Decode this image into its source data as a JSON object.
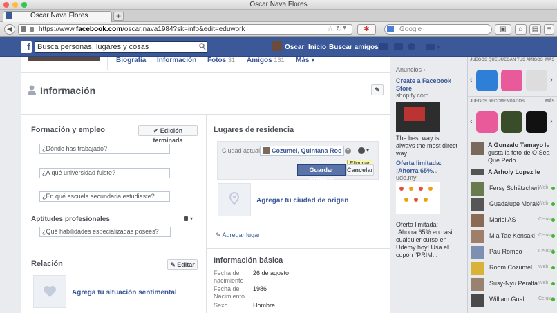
{
  "window": {
    "title": "Oscar Nava Flores",
    "tab_title": "Oscar Nava Flores",
    "new_tab": "+"
  },
  "toolbar": {
    "url_prefix": "https://www.",
    "url_domain": "facebook.com",
    "url_path": "/oscar.nava1984?sk=info&edit=eduwork",
    "search_placeholder": "Google"
  },
  "fb": {
    "search": "Busca personas, lugares y cosas",
    "user": "Oscar",
    "home": "Inicio",
    "find_friends": "Buscar amigos"
  },
  "profile_tabs": [
    {
      "label": "Biografía"
    },
    {
      "label": "Información"
    },
    {
      "label": "Fotos",
      "count": "31"
    },
    {
      "label": "Amigos",
      "count": "161"
    },
    {
      "label": "Más"
    }
  ],
  "info": {
    "title": "Información"
  },
  "work": {
    "title": "Formación y empleo",
    "done_button": "Edición terminada",
    "work_placeholder": "¿Dónde has trabajado?",
    "university_placeholder": "¿A qué universidad fuiste?",
    "school_placeholder": "¿En qué escuela secundaria estudiaste?",
    "skills_title": "Aptitudes profesionales",
    "skills_placeholder": "¿Qué habilidades especializadas posees?"
  },
  "relation": {
    "title": "Relación",
    "edit_button": "Editar",
    "add_text": "Agrega tu situación sentimental"
  },
  "places": {
    "title": "Lugares de residencia",
    "current_city_label": "Ciudad actual",
    "current_city_value": "Cozumel, Quintana Roo, Mexi",
    "tooltip": "Eliminar",
    "save_button": "Guardar cambios",
    "cancel_button": "Cancelar",
    "hometown_link": "Agregar tu ciudad de origen",
    "add_place": "Agregar lugar"
  },
  "basic": {
    "title": "Información básica",
    "rows": [
      {
        "label": "Fecha de nacimiento",
        "value": "26 de agosto"
      },
      {
        "label": "Fecha de Nacimiento",
        "value": "1986"
      },
      {
        "label": "Sexo",
        "value": "Hombre"
      }
    ]
  },
  "ads": {
    "header": "Anuncios",
    "items": [
      {
        "title": "Create a Facebook Store",
        "domain": "shopify.com",
        "body": "The best way is always the most direct way"
      },
      {
        "title": "Oferta limitada: ¡Ahorra 65%...",
        "domain": "ude.my",
        "body": ""
      },
      {
        "title": "",
        "domain": "",
        "body": "Oferta limitada: ¡Ahorra 65% en casi cualquier curso en Udemy hoy! Usa el cupón \"PRIM..."
      }
    ]
  },
  "games": {
    "friends_title": "JUEGOS QUE JUEGAN TUS AMIGOS",
    "recommended_title": "JUEGOS RECOMENDADOS",
    "more": "MÁS"
  },
  "ticker": {
    "actor": "A Gonzalo Tamayo",
    "text": " le gusta la foto de O Sea Que Pedo",
    "second": "A Arholy Lopez le gusta"
  },
  "chat": [
    {
      "name": "Fersy Schätzchen ...",
      "status": "Web"
    },
    {
      "name": "Guadalupe Morale...",
      "status": "Web"
    },
    {
      "name": "Mariel AS",
      "status": "Celular"
    },
    {
      "name": "Mia Tae Kensaki",
      "status": "Celular"
    },
    {
      "name": "Pau Romeo",
      "status": "Celular"
    },
    {
      "name": "Room Cozumel",
      "status": "Web"
    },
    {
      "name": "Susy-Nyu Peralta",
      "status": "Web"
    },
    {
      "name": "William Gual",
      "status": "Celular"
    }
  ],
  "colors": {
    "fb_blue": "#3b5998",
    "link": "#3b5998",
    "online": "#42b72a"
  }
}
